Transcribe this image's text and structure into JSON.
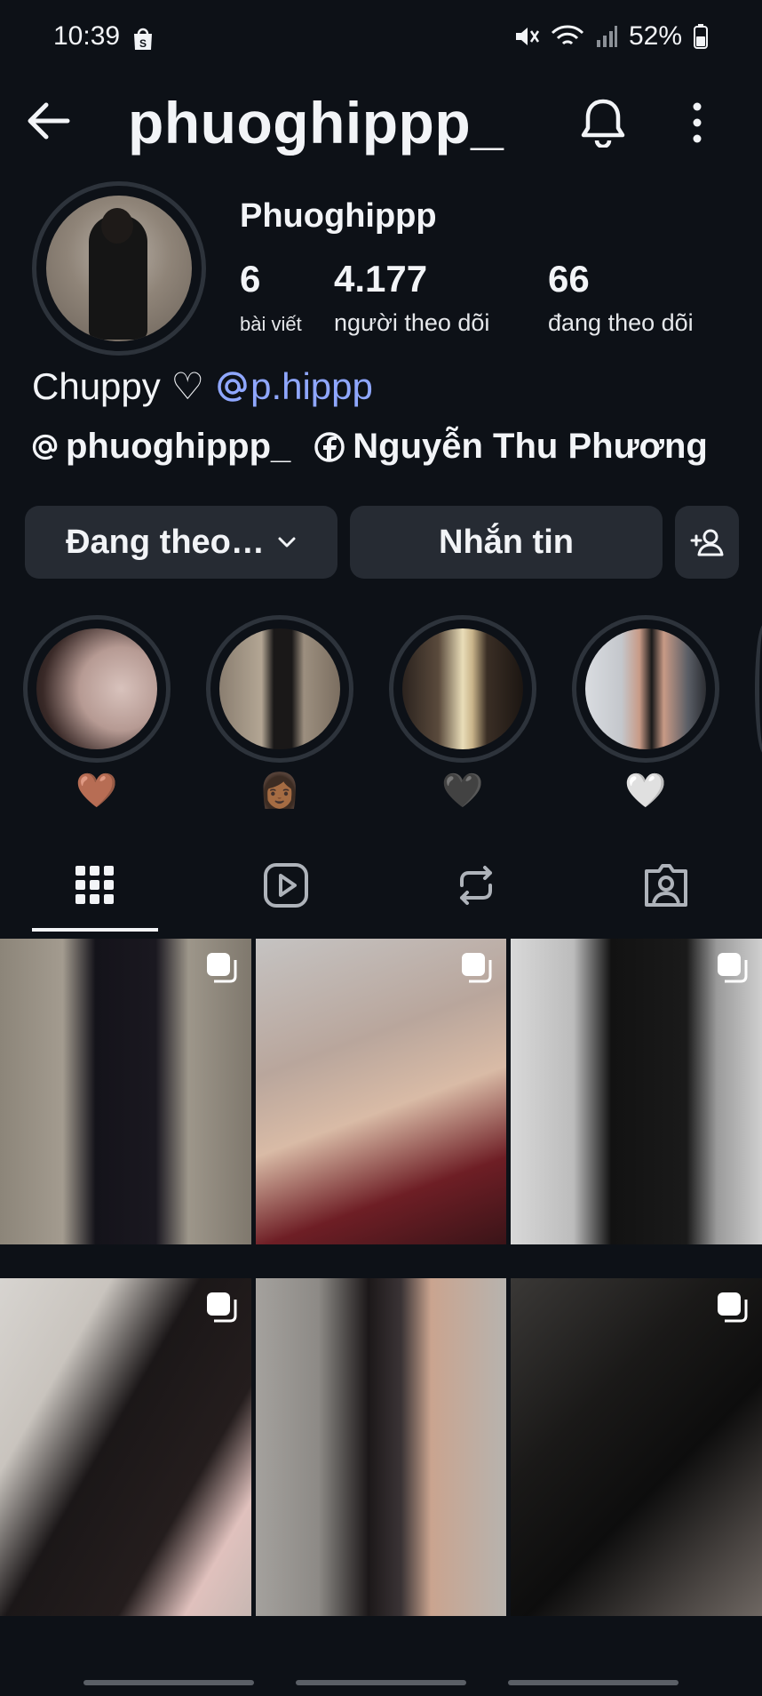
{
  "status_bar": {
    "time": "10:39",
    "battery": "52%",
    "icons": [
      "shopee-bag-icon",
      "mute-icon",
      "wifi-icon",
      "signal-icon",
      "battery-icon"
    ]
  },
  "header": {
    "username": "phuoghippp_",
    "icons": [
      "back-arrow-icon",
      "bell-icon",
      "more-vertical-icon"
    ]
  },
  "profile": {
    "display_name": "Phuoghippp",
    "stats": [
      {
        "value": "6",
        "label": "bài viết"
      },
      {
        "value": "4.177",
        "label": "người theo dõi"
      },
      {
        "value": "66",
        "label": "đang theo dõi"
      }
    ],
    "bio_text": "Chuppy ♡",
    "bio_mention": "p.hippp",
    "links": [
      {
        "icon": "threads-icon",
        "text": "phuoghippp_"
      },
      {
        "icon": "facebook-icon",
        "text": "Nguyễn Thu Phương"
      }
    ]
  },
  "actions": {
    "following_label": "Đang theo…",
    "message_label": "Nhắn tin"
  },
  "highlights": [
    {
      "emoji": "🤎"
    },
    {
      "emoji": "👩🏾"
    },
    {
      "emoji": "🖤"
    },
    {
      "emoji": "🤍"
    }
  ],
  "tabs": [
    "grid-icon",
    "reels-icon",
    "reposts-icon",
    "tagged-icon"
  ],
  "colors": {
    "background": "#0d1117",
    "button": "#262b33",
    "mention": "#8fa7ff",
    "text": "#f2f4f7"
  }
}
